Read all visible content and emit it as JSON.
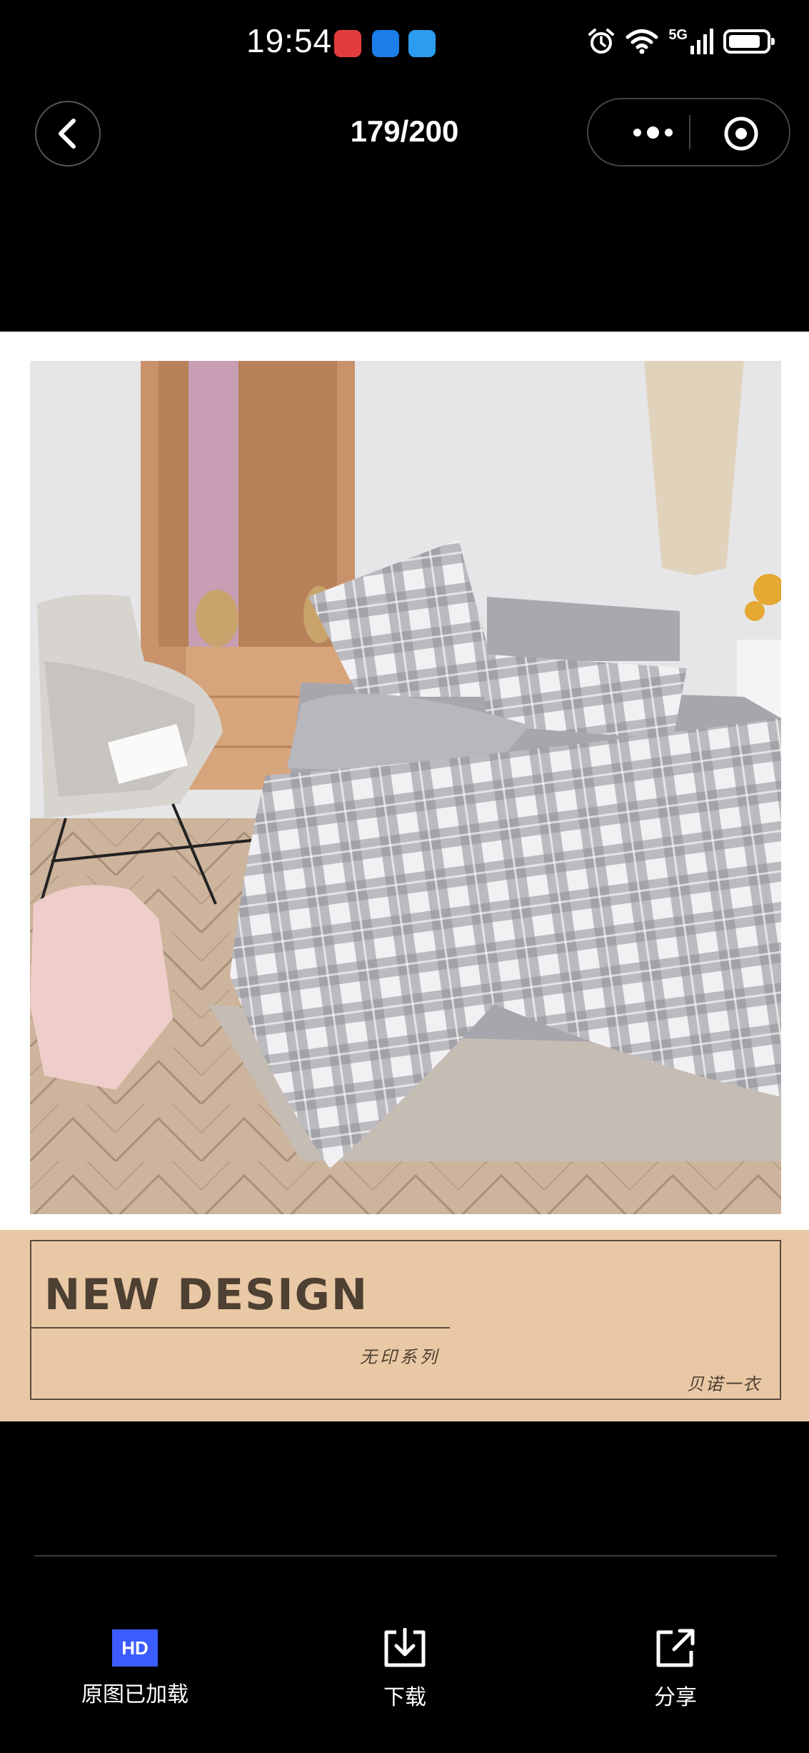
{
  "status_bar": {
    "time": "19:54",
    "network": "5G",
    "apps": [
      "huawei-appgallery-icon",
      "browser-icon",
      "weather-icon"
    ],
    "battery_level": 0.85
  },
  "nav": {
    "counter": "179/200"
  },
  "banner": {
    "title": "NEW DESIGN",
    "subtitle": "无印系列",
    "brand": "贝诺一衣"
  },
  "actions": {
    "hd_badge": "HD",
    "original_loaded": "原图已加载",
    "download": "下载",
    "share": "分享"
  },
  "colors": {
    "background": "#000000",
    "banner": "#e9c9a5",
    "hd_badge": "#3c5cff"
  }
}
